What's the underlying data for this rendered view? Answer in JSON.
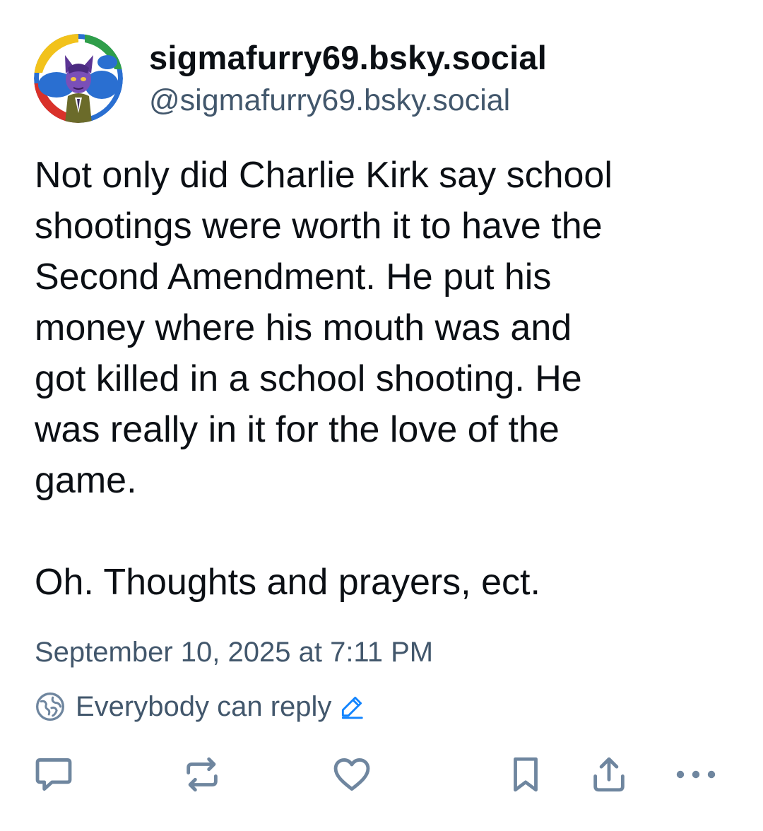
{
  "post": {
    "author": {
      "display_name": "sigmafurry69.bsky.social",
      "handle": "@sigmafurry69.bsky.social"
    },
    "text_lines": [
      "Not only did Charlie Kirk say school",
      "shootings were worth it to have the",
      "Second Amendment. He put his",
      "money where his mouth was and",
      "got killed in a school shooting. He",
      "was really in it for the love of the",
      "game."
    ],
    "text_last": "Oh. Thoughts and prayers, ect.",
    "timestamp": "September 10, 2025 at 7:11 PM",
    "reply_setting": "Everybody can reply"
  },
  "icons": {
    "reply": "speech-bubble-icon",
    "repost": "repost-arrows-icon",
    "like": "heart-icon",
    "bookmark": "bookmark-icon",
    "share": "share-upload-icon",
    "more": "ellipsis-icon",
    "reply_setting": "globe-icon",
    "edit": "pencil-icon"
  },
  "colors": {
    "text": "#0b0f14",
    "secondary": "#42576c",
    "accent": "#1083fe",
    "icon": "#6f869f"
  }
}
